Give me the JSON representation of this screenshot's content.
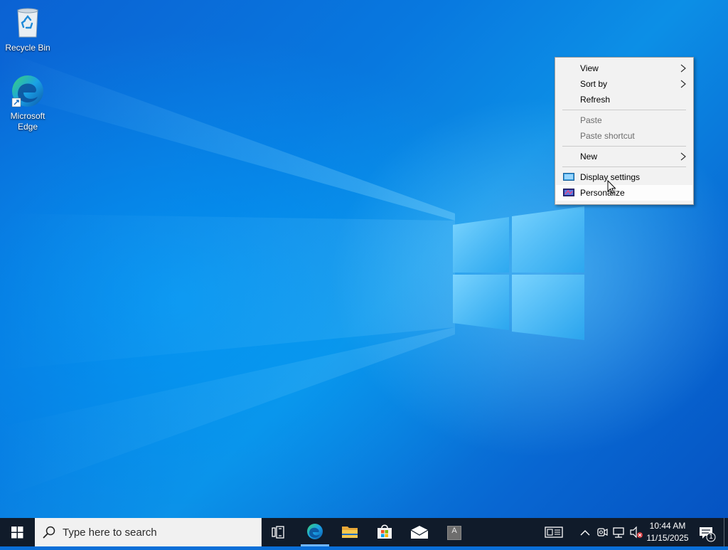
{
  "desktop": {
    "icons": [
      {
        "label": "Recycle Bin",
        "icon": "recycle-bin-icon"
      },
      {
        "label": "Microsoft Edge",
        "icon": "edge-icon"
      }
    ]
  },
  "context_menu": {
    "items": [
      {
        "label": "View",
        "submenu": true,
        "enabled": true
      },
      {
        "label": "Sort by",
        "submenu": true,
        "enabled": true
      },
      {
        "label": "Refresh",
        "enabled": true
      },
      {
        "separator": true
      },
      {
        "label": "Paste",
        "enabled": false
      },
      {
        "label": "Paste shortcut",
        "enabled": false
      },
      {
        "separator": true
      },
      {
        "label": "New",
        "submenu": true,
        "enabled": true
      },
      {
        "separator": true
      },
      {
        "label": "Display settings",
        "icon": "display-settings-icon",
        "enabled": true
      },
      {
        "label": "Personalize",
        "icon": "personalize-icon",
        "enabled": true,
        "hovered": true
      }
    ]
  },
  "taskbar": {
    "search_placeholder": "Type here to search",
    "pinned": [
      "start-icon",
      "task-view-icon",
      "edge-icon",
      "file-explorer-icon",
      "store-icon",
      "mail-icon",
      "app-icon"
    ],
    "app_icon_letter": "A",
    "tray": {
      "time": "10:44 AM",
      "date": "11/15/2025",
      "notification_count": "1"
    }
  },
  "colors": {
    "accent": "#0078d7",
    "taskbar": "#101b2a",
    "menu_bg": "#f2f2f2"
  }
}
